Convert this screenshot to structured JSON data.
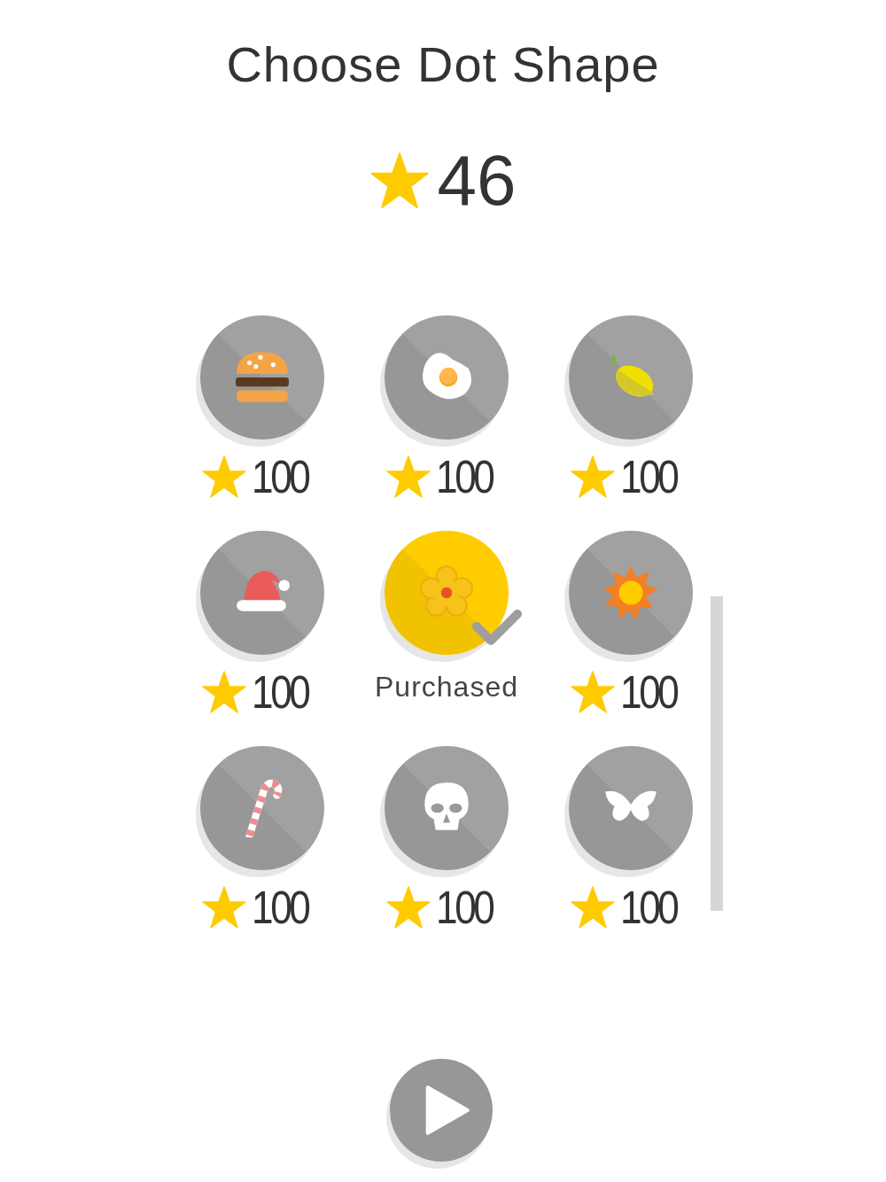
{
  "title": "Choose Dot Shape",
  "balance": "46",
  "shapes": [
    {
      "kind": "burger",
      "purchased": false,
      "price": "100"
    },
    {
      "kind": "egg",
      "purchased": false,
      "price": "100"
    },
    {
      "kind": "lemon",
      "purchased": false,
      "price": "100"
    },
    {
      "kind": "hat",
      "purchased": false,
      "price": "100"
    },
    {
      "kind": "flower",
      "purchased": true,
      "status": "Purchased"
    },
    {
      "kind": "sun",
      "purchased": false,
      "price": "100"
    },
    {
      "kind": "cane",
      "purchased": false,
      "price": "100"
    },
    {
      "kind": "skull",
      "purchased": false,
      "price": "100"
    },
    {
      "kind": "butterfly",
      "purchased": false,
      "price": "100"
    }
  ]
}
